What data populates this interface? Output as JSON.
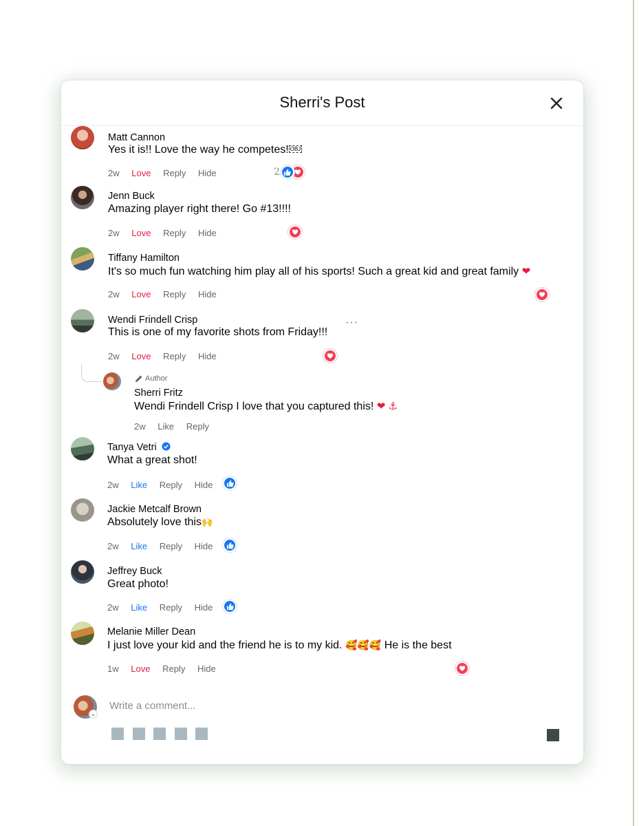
{
  "modal": {
    "title": "Sherri's Post"
  },
  "comments": [
    {
      "name": "Matt Cannon",
      "text": "Yes it is!! Love the way he competes!",
      "obj": "OBJ",
      "time": "2w",
      "reaction_label": "Love",
      "reply": "Reply",
      "hide": "Hide",
      "reaction_count": "2",
      "reactions": [
        "like",
        "love"
      ]
    },
    {
      "name": "Jenn Buck",
      "text": "Amazing player right there! Go #13!!!!",
      "time": "2w",
      "reaction_label": "Love",
      "reply": "Reply",
      "hide": "Hide",
      "reactions": [
        "love"
      ]
    },
    {
      "name": "Tiffany Hamilton",
      "text": "It's so much fun watching him play all of his sports! Such a great kid and great family",
      "emoji": "❤",
      "time": "2w",
      "reaction_label": "Love",
      "reply": "Reply",
      "hide": "Hide",
      "reactions": [
        "love"
      ]
    },
    {
      "name": "Wendi Frindell Crisp",
      "text": "This is one of my favorite shots from Friday!!!",
      "more": "···",
      "time": "2w",
      "reaction_label": "Love",
      "reply": "Reply",
      "hide": "Hide",
      "reactions": [
        "love"
      ]
    },
    {
      "author_tag": "Author",
      "name": "Sherri Fritz",
      "mention": "Wendi Frindell Crisp",
      "text": " I love that you captured this! ",
      "emoji": "❤ ⚓",
      "time": "2w",
      "reaction_label": "Like",
      "reply": "Reply"
    },
    {
      "name": "Tanya Vetri",
      "verified": true,
      "text": "What a great shot!",
      "time": "2w",
      "reaction_label": "Like",
      "reply": "Reply",
      "hide": "Hide",
      "reactions": [
        "like"
      ]
    },
    {
      "name": "Jackie Metcalf Brown",
      "text": "Absolutely love this",
      "emoji": "🙌",
      "time": "2w",
      "reaction_label": "Like",
      "reply": "Reply",
      "hide": "Hide",
      "reactions": [
        "like"
      ]
    },
    {
      "name": "Jeffrey Buck",
      "text": "Great photo!",
      "time": "2w",
      "reaction_label": "Like",
      "reply": "Reply",
      "hide": "Hide",
      "reactions": [
        "like"
      ]
    },
    {
      "name": "Melanie Miller Dean",
      "text": "I just love your kid and the friend he is to my kid. ",
      "emoji": "🥰🥰🥰",
      "text_after": " He is the best",
      "time": "1w",
      "reaction_label": "Love",
      "reply": "Reply",
      "hide": "Hide",
      "reactions": [
        "love"
      ]
    }
  ],
  "composer": {
    "placeholder": "Write a comment..."
  },
  "colors": {
    "love": "#e41e3f",
    "like": "#1877f2",
    "secondary_text": "#65676b"
  }
}
